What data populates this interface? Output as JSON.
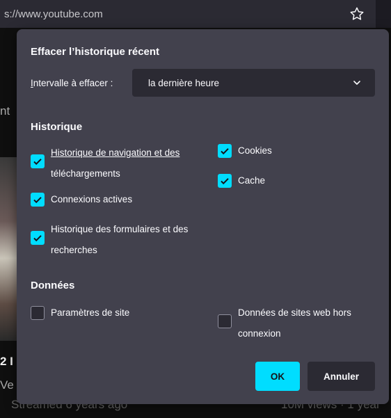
{
  "browser": {
    "url_text": "s://www.youtube.com",
    "background_text": {
      "side_fragment": "nt",
      "title_fragment": "2 I",
      "channel_fragment": "Ve",
      "meta_left": "Streamed 6 years ago",
      "meta_right": "10M views · 1 year"
    }
  },
  "dialog": {
    "title": "Effacer l’historique récent",
    "range": {
      "label_prefix": "",
      "label_accesskey": "I",
      "label_rest": "ntervalle à effacer :",
      "selected": "la dernière heure"
    },
    "history": {
      "heading": "Historique",
      "items": [
        {
          "line1": "Historique de navigation et des",
          "line2": "téléchargements",
          "checked": true
        },
        {
          "line1": "Connexions actives",
          "line2": "",
          "checked": true
        },
        {
          "line1": "Historique des formulaires et des",
          "line2": "recherches",
          "checked": true
        },
        {
          "line1": "Cookies",
          "line2": "",
          "checked": true
        },
        {
          "line1": "Cache",
          "line2": "",
          "checked": true
        }
      ]
    },
    "data": {
      "heading": "Données",
      "items": [
        {
          "line1": "Paramètres de site",
          "line2": "",
          "checked": false
        },
        {
          "line1": "Données de sites web hors",
          "line2": "connexion",
          "checked": false
        }
      ]
    },
    "buttons": {
      "ok": "OK",
      "cancel": "Annuler"
    }
  },
  "colors": {
    "accent": "#00ddff",
    "dialog_bg": "#42414d",
    "field_bg": "#2b2a33"
  }
}
